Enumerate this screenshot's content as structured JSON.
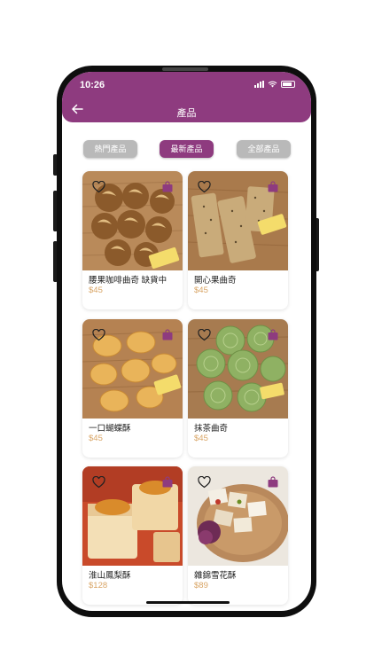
{
  "status": {
    "time": "10:26"
  },
  "header": {
    "title": "產品"
  },
  "tabs": [
    {
      "label": "熱門產品",
      "active": false
    },
    {
      "label": "最新產品",
      "active": true
    },
    {
      "label": "全部產品",
      "active": false
    }
  ],
  "products": [
    {
      "name": "腰果咖啡曲奇 缺貨中",
      "price": "$45"
    },
    {
      "name": "開心果曲奇",
      "price": "$45"
    },
    {
      "name": "一口蝴蝶酥",
      "price": "$45"
    },
    {
      "name": "抹茶曲奇",
      "price": "$45"
    },
    {
      "name": "淮山鳳梨酥",
      "price": "$128"
    },
    {
      "name": "雜錦雪花酥",
      "price": "$89"
    }
  ],
  "colors": {
    "brand": "#8e3b7f",
    "price": "#d9a566",
    "tab_inactive": "#b9b9b9"
  }
}
